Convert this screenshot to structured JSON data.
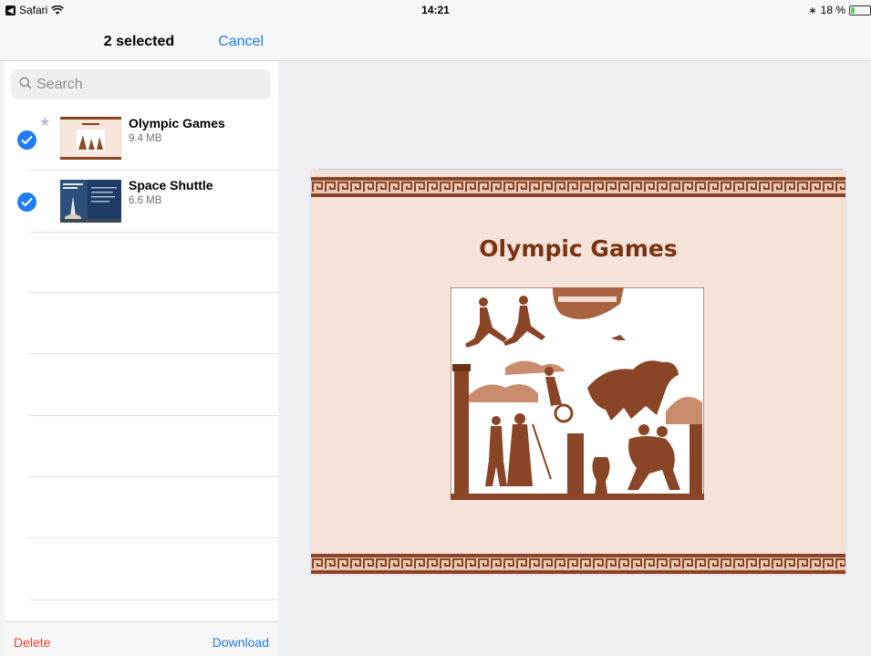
{
  "status_bar": {
    "back_app": "Safari",
    "time": "14:21",
    "battery_text": "18 %",
    "battery_level": 0.18
  },
  "left_panel": {
    "title": "2 selected",
    "cancel_label": "Cancel",
    "search_placeholder": "Search",
    "files": [
      {
        "name": "Olympic Games",
        "size": "9.4 MB",
        "selected": true,
        "starred": true
      },
      {
        "name": "Space Shuttle",
        "size": "6.6 MB",
        "selected": true,
        "starred": false
      }
    ],
    "toolbar": {
      "delete_label": "Delete",
      "download_label": "Download"
    }
  },
  "preview": {
    "slide_title": "Olympic Games"
  },
  "colors": {
    "accent": "#1f7cf2",
    "destructive": "#ff3b30",
    "slide_bg": "#f5e3da",
    "slide_title": "#7a3310"
  }
}
